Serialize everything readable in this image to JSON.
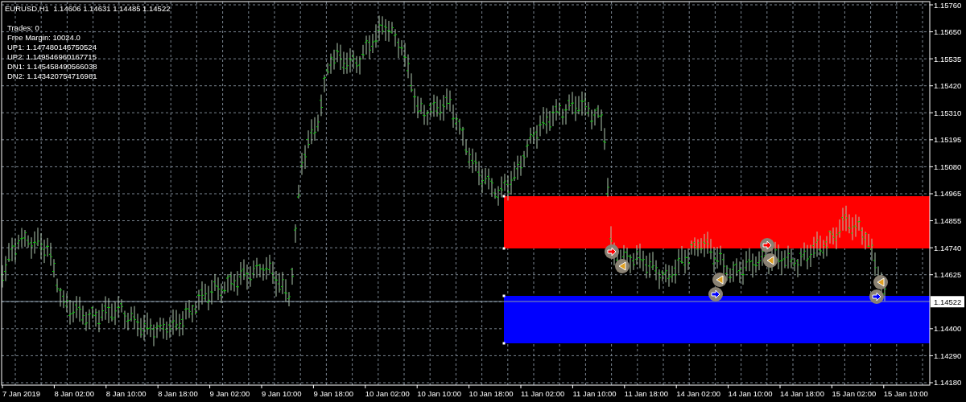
{
  "chart_header": "EURUSD,H1  1.14606 1.14631 1.14485 1.14522",
  "info_lines": [
    "Trades: 0",
    "Free Margin: 10024.0",
    "UP1: 1.147480146750524",
    "UP2: 1.149546960167715",
    "DN1: 1.145458490566038",
    "DN2: 1.143420754716981"
  ],
  "zones": [
    {
      "color": "#ff0000"
    },
    {
      "color": "#0000ff"
    }
  ],
  "trade_markers": [
    {
      "kind": "arrow",
      "color": "#ff0000"
    },
    {
      "kind": "triangle",
      "color": "#e0a020"
    },
    {
      "kind": "triangle",
      "color": "#e0a020"
    },
    {
      "kind": "arrow",
      "color": "#0000ff"
    },
    {
      "kind": "arrow",
      "color": "#ff0000"
    },
    {
      "kind": "triangle",
      "color": "#e0a020"
    },
    {
      "kind": "triangle",
      "color": "#e0a020"
    },
    {
      "kind": "arrow",
      "color": "#0000ff"
    }
  ],
  "price_axis": [
    {
      "kind": "tick",
      "label": "1.15760"
    },
    {
      "kind": "tick",
      "label": "1.15650"
    },
    {
      "kind": "tick",
      "label": "1.15535"
    },
    {
      "kind": "tick",
      "label": "1.15420"
    },
    {
      "kind": "tick",
      "label": "1.15310"
    },
    {
      "kind": "tick",
      "label": "1.15195"
    },
    {
      "kind": "tick",
      "label": "1.15080"
    },
    {
      "kind": "tick",
      "label": "1.14965"
    },
    {
      "kind": "tick",
      "label": "1.14855"
    },
    {
      "kind": "tick",
      "label": "1.14740"
    },
    {
      "kind": "tick",
      "label": "1.14625"
    },
    {
      "kind": "current",
      "label": "1.14522"
    },
    {
      "kind": "tick",
      "label": "1.14400"
    },
    {
      "kind": "tick",
      "label": "1.14290"
    },
    {
      "kind": "tick",
      "label": "1.14180"
    }
  ],
  "time_axis": [
    "7 Jan 2019",
    "8 Jan 02:00",
    "8 Jan 10:00",
    "8 Jan 18:00",
    "9 Jan 02:00",
    "9 Jan 10:00",
    "9 Jan 18:00",
    "10 Jan 02:00",
    "10 Jan 10:00",
    "10 Jan 18:00",
    "11 Jan 02:00",
    "11 Jan 10:00",
    "11 Jan 18:00",
    "14 Jan 02:00",
    "14 Jan 10:00",
    "14 Jan 18:00",
    "15 Jan 02:00",
    "15 Jan 10:00"
  ]
}
